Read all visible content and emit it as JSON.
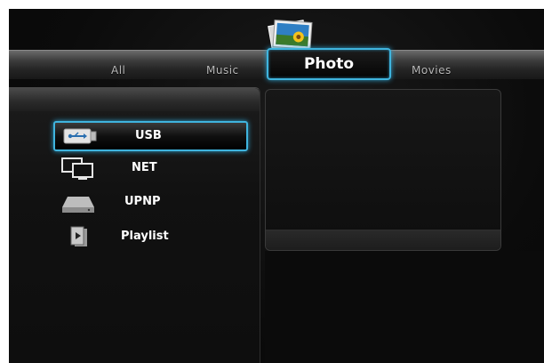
{
  "tabs": [
    {
      "label": "All"
    },
    {
      "label": "Music"
    },
    {
      "label": "Photo",
      "active": true
    },
    {
      "label": "Movies"
    }
  ],
  "active_tab_icon": "photo-icon",
  "devices": [
    {
      "label": "USB",
      "icon": "usb-icon",
      "selected": true
    },
    {
      "label": "NET",
      "icon": "network-icon"
    },
    {
      "label": "UPNP",
      "icon": "upnp-icon"
    },
    {
      "label": "Playlist",
      "icon": "playlist-icon"
    }
  ],
  "colors": {
    "highlight": "#3fb4de",
    "background": "#0c0c0c",
    "text": "#ffffff",
    "tab_text": "#b8b8b8"
  }
}
